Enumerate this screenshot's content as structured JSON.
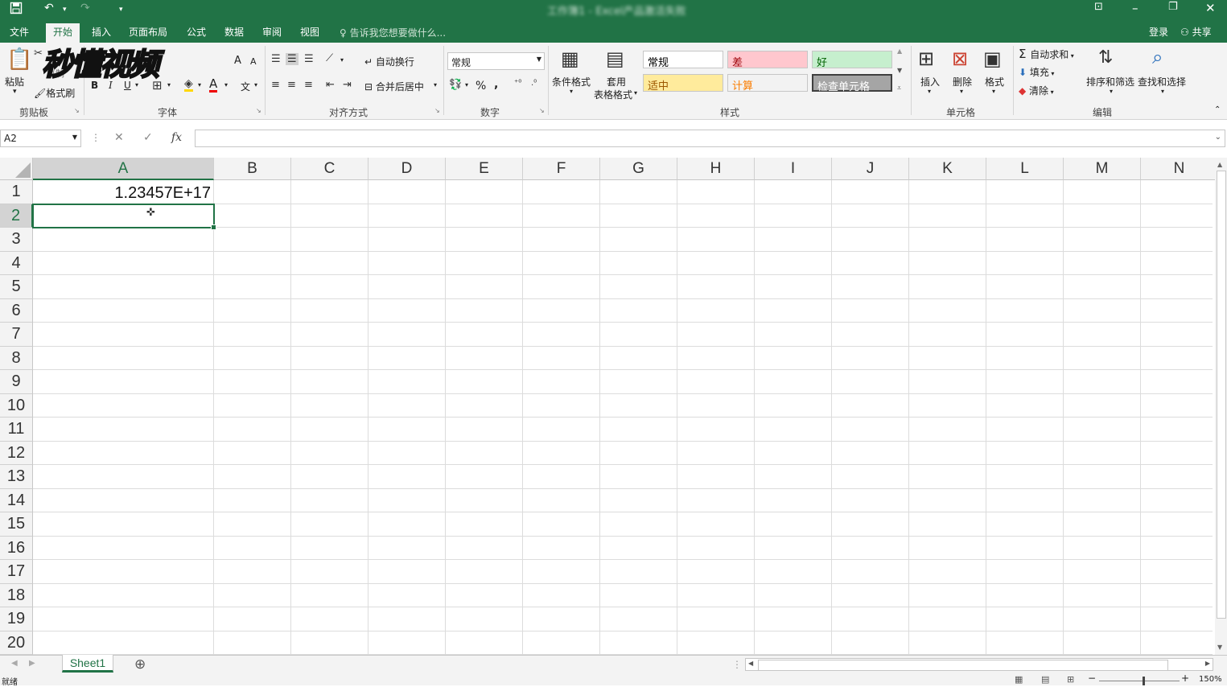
{
  "titlebar": {
    "title": "工作簿1 - Excel产品激活失败",
    "save_icon": "save-icon",
    "undo_icon": "undo-icon",
    "redo_icon": "redo-icon"
  },
  "tabs": [
    "文件",
    "开始",
    "插入",
    "页面布局",
    "公式",
    "数据",
    "审阅",
    "视图"
  ],
  "tellme": "告诉我您想要做什么...",
  "account": {
    "login": "登录",
    "share": "共享"
  },
  "watermark": "秒懂视频",
  "ribbon": {
    "clipboard": {
      "paste": "粘贴",
      "copy": "复制",
      "format_painter": "格式刷",
      "label": "剪贴板"
    },
    "font": {
      "bold": "B",
      "italic": "I",
      "underline": "U",
      "grow": "A",
      "shrink": "A",
      "font_color": "A",
      "phonetic": "文",
      "label": "字体"
    },
    "alignment": {
      "wrap": "自动换行",
      "merge": "合并后居中",
      "label": "对齐方式"
    },
    "number": {
      "format": "常规",
      "percent": "%",
      "comma": ",",
      "label": "数字"
    },
    "styles": {
      "conditional": [
        "条件格式"
      ],
      "table": [
        "套用",
        "表格格式"
      ],
      "cells": [
        {
          "text": "常规",
          "bg": "#ffffff",
          "fg": "#000000"
        },
        {
          "text": "差",
          "bg": "#ffc7ce",
          "fg": "#9c0006"
        },
        {
          "text": "好",
          "bg": "#c6efce",
          "fg": "#006100"
        },
        {
          "text": "适中",
          "bg": "#ffeb9c",
          "fg": "#9c5700"
        },
        {
          "text": "计算",
          "bg": "#f2f2f2",
          "fg": "#fa7d00"
        },
        {
          "text": "检查单元格",
          "bg": "#a5a5a5",
          "fg": "#ffffff"
        }
      ],
      "label": "样式"
    },
    "cells": {
      "insert": "插入",
      "delete": "删除",
      "format": "格式",
      "label": "单元格"
    },
    "editing": {
      "autosum": "自动求和",
      "fill": "填充",
      "clear": "清除",
      "sort": "排序和筛选",
      "find": "查找和选择",
      "label": "编辑"
    }
  },
  "formula_bar": {
    "name_box": "A2",
    "cancel": "✕",
    "enter": "✓",
    "fx": "fx",
    "content": ""
  },
  "columns": [
    "A",
    "B",
    "C",
    "D",
    "E",
    "F",
    "G",
    "H",
    "I",
    "J",
    "K",
    "L",
    "M",
    "N"
  ],
  "rows": [
    "1",
    "2",
    "3",
    "4",
    "5",
    "6",
    "7",
    "8",
    "9",
    "10",
    "11",
    "12",
    "13",
    "14",
    "15",
    "16",
    "17",
    "18",
    "19",
    "20"
  ],
  "selected": {
    "column": "A",
    "row": "2"
  },
  "cells": {
    "A1": "1.23457E+17"
  },
  "sheets": [
    "Sheet1"
  ],
  "status": {
    "mode": "就绪",
    "zoom": "150%"
  },
  "colors": {
    "excel_green": "#217346",
    "ribbon_bg": "#f3f3f3"
  }
}
